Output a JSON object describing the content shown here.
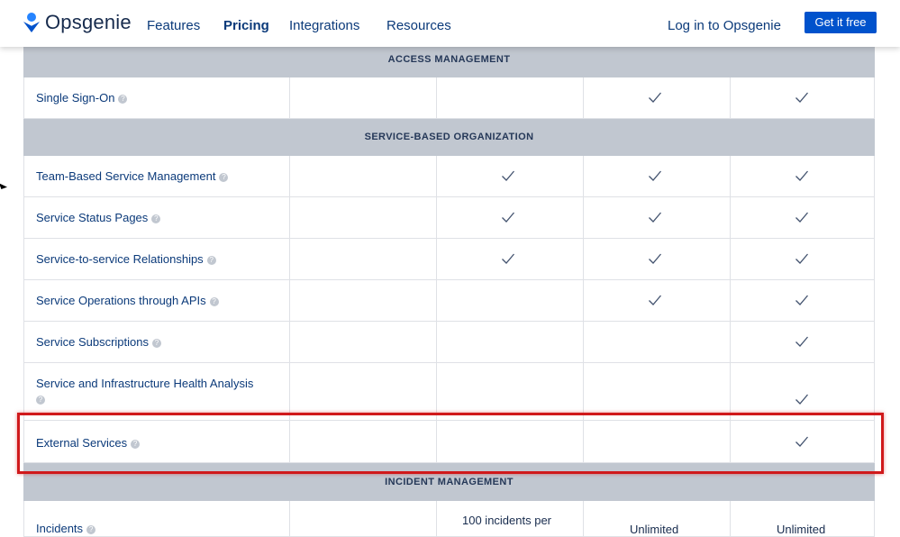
{
  "nav": {
    "logo_text": "Opsgenie",
    "links": [
      "Features",
      "Pricing",
      "Integrations",
      "Resources"
    ],
    "login": "Log in to Opsgenie",
    "cta": "Get it free"
  },
  "sections": {
    "access": "ACCESS MANAGEMENT",
    "service": "SERVICE-BASED ORGANIZATION",
    "incident": "INCIDENT MANAGEMENT"
  },
  "rows": [
    {
      "label": "Single Sign-On",
      "checks": [
        false,
        false,
        true,
        true
      ]
    },
    {
      "label": "Team-Based Service Management",
      "checks": [
        false,
        true,
        true,
        true
      ]
    },
    {
      "label": "Service Status Pages",
      "checks": [
        false,
        true,
        true,
        true
      ]
    },
    {
      "label": "Service-to-service Relationships",
      "checks": [
        false,
        true,
        true,
        true
      ]
    },
    {
      "label": "Service Operations through APIs",
      "checks": [
        false,
        false,
        true,
        true
      ]
    },
    {
      "label": "Service Subscriptions",
      "checks": [
        false,
        false,
        false,
        true
      ]
    },
    {
      "label": "Service and Infrastructure Health Analysis",
      "checks": [
        false,
        false,
        false,
        true
      ]
    },
    {
      "label": "External Services",
      "checks": [
        false,
        false,
        false,
        true
      ]
    },
    {
      "label": "Incidents",
      "checks": [
        false,
        false,
        false,
        false
      ]
    }
  ],
  "incidents": {
    "col2": "100 incidents per",
    "col3": "Unlimited",
    "col4": "Unlimited"
  },
  "colors": {
    "brand": "#0052cc",
    "section_bg": "#c1c7d0",
    "highlight": "#d0191b",
    "link": "#0b3a7a"
  }
}
